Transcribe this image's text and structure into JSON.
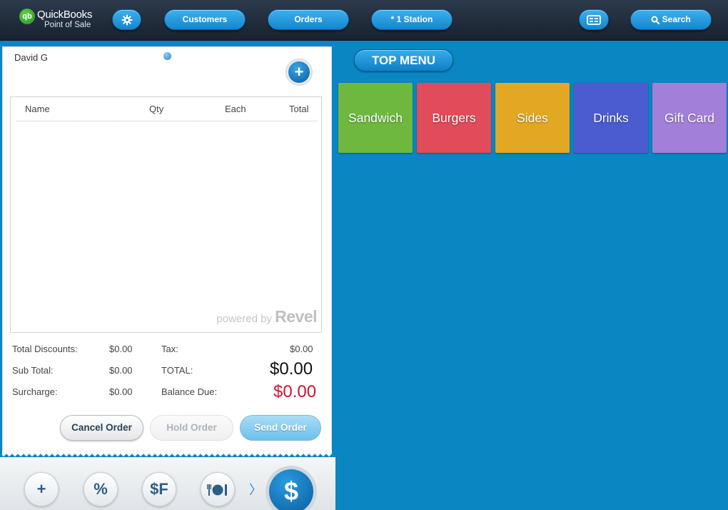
{
  "header": {
    "logo_line1": "QuickBooks",
    "logo_line2": "Point of Sale",
    "logo_mark": "qb",
    "settings_icon": "gear-icon",
    "customers": "Customers",
    "orders": "Orders",
    "station": "* 1 Station",
    "layout_icon": "table-layout-icon",
    "search": "Search"
  },
  "order": {
    "customer": "David G",
    "columns": [
      "Name",
      "Qty",
      "Each",
      "Total"
    ],
    "powered_by": "powered by",
    "brand": "Revel"
  },
  "totals": {
    "discounts_label": "Total Discounts:",
    "discounts_value": "$0.00",
    "subtotal_label": "Sub Total:",
    "subtotal_value": "$0.00",
    "surcharge_label": "Surcharge:",
    "surcharge_value": "$0.00",
    "tax_label": "Tax:",
    "tax_value": "$0.00",
    "total_label": "TOTAL:",
    "total_value": "$0.00",
    "balance_label": "Balance Due:",
    "balance_value": "$0.00"
  },
  "actions": {
    "cancel": "Cancel Order",
    "hold": "Hold Order",
    "send": "Send Order"
  },
  "toolbar": {
    "add": "+",
    "discount": "%",
    "sf": "$F",
    "dining_icon": "dining-icon",
    "chevron": "〉",
    "pay": "$"
  },
  "menu": {
    "title": "TOP MENU",
    "categories": [
      {
        "label": "Sandwich",
        "color": "#6fb83f"
      },
      {
        "label": "Burgers",
        "color": "#e14b5a"
      },
      {
        "label": "Sides",
        "color": "#e3a823"
      },
      {
        "label": "Drinks",
        "color": "#4b5bd0"
      },
      {
        "label": "Gift Card",
        "color": "#a27fd8"
      }
    ]
  }
}
